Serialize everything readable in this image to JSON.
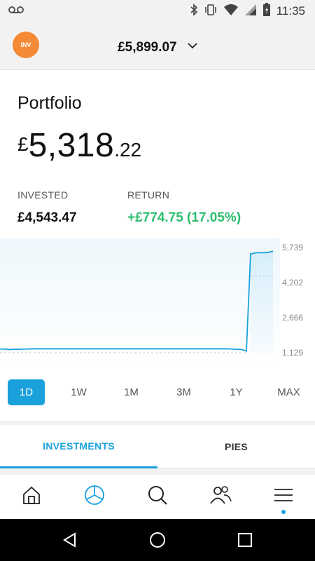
{
  "status_bar": {
    "time": "11:35",
    "icons": [
      "voicemail-icon",
      "bluetooth-icon",
      "vibrate-icon",
      "wifi-icon",
      "signal-icon",
      "battery-icon"
    ]
  },
  "header": {
    "avatar_label": "INV",
    "account_value": "£5,899.07",
    "account_icon": "chevron-down-icon"
  },
  "portfolio": {
    "title": "Portfolio",
    "currency": "£",
    "value_int": "5,318",
    "value_dec": ".22",
    "invested_label": "INVESTED",
    "invested_value": "£4,543.47",
    "return_label": "RETURN",
    "return_value": "+£774.75 (17.05%)"
  },
  "colors": {
    "accent": "#1aa1dc",
    "positive": "#2dbd6e",
    "avatar": "#f58a36"
  },
  "chart_data": {
    "type": "line",
    "y_ticks": [
      "5,739",
      "4,202",
      "2,666",
      "1,129"
    ],
    "ylim": [
      1129,
      5739
    ],
    "note_values": {
      "start_level": 1300,
      "end_level": 5580
    },
    "series": [
      {
        "values": [
          1290,
          1290,
          1270,
          1280,
          1280,
          1290,
          1290,
          1300,
          1300,
          1300,
          1300,
          1300,
          1300,
          1300,
          1300,
          1300,
          1300,
          1300,
          1300,
          1300,
          1300,
          1300,
          1300,
          1300,
          1300,
          1300,
          1300,
          1300,
          1300,
          1300,
          1300,
          1300,
          1300,
          1300,
          1300,
          1300,
          1300,
          1300,
          1300,
          1300,
          1300,
          1300,
          1300,
          1300,
          1300,
          1300,
          1300,
          1300,
          1300,
          1300,
          1290,
          1280,
          1270,
          1200,
          5460,
          5500,
          5520,
          5510,
          5530,
          5580
        ]
      }
    ]
  },
  "ranges": {
    "items": [
      "1D",
      "1W",
      "1M",
      "3M",
      "1Y",
      "MAX"
    ],
    "active": "1D"
  },
  "tabs": {
    "items": [
      "INVESTMENTS",
      "PIES"
    ],
    "active": "INVESTMENTS"
  },
  "bottom_nav": {
    "items": [
      "home-icon",
      "portfolio-pie-icon",
      "search-icon",
      "community-icon",
      "menu-icon"
    ],
    "active": "portfolio-pie-icon"
  },
  "system_nav": {
    "items": [
      "back-icon",
      "home-circle-icon",
      "recents-icon"
    ]
  }
}
